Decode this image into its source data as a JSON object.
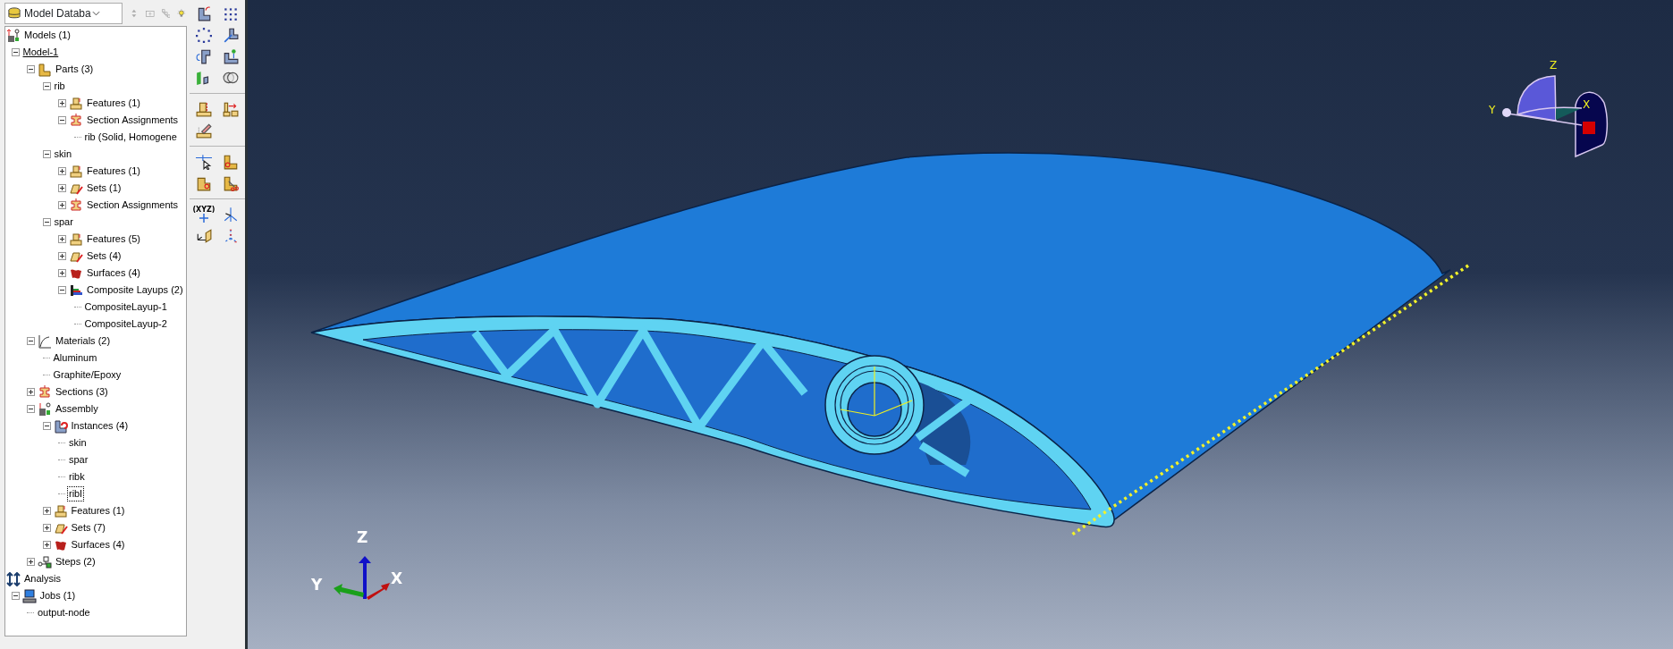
{
  "model_tree": {
    "selector": {
      "value": "Model Databa"
    },
    "nodes": [
      {
        "label": "Models (1)",
        "kind": "models",
        "selected": false,
        "children": [
          {
            "label": "Model-1",
            "kind": "model",
            "expanded": true,
            "current": true,
            "selected": false,
            "children": [
              {
                "label": "Parts (3)",
                "kind": "parts",
                "expanded": true,
                "selected": false,
                "children": [
                  {
                    "label": "rib",
                    "kind": "part",
                    "expanded": true,
                    "selected": false,
                    "children": [
                      {
                        "label": "Features (1)",
                        "kind": "features",
                        "expanded": false,
                        "selected": false
                      },
                      {
                        "label": "Section Assignments",
                        "kind": "section",
                        "expanded": true,
                        "selected": false,
                        "children": [
                          {
                            "label": "rib (Solid, Homogene",
                            "kind": "leaf",
                            "selected": false
                          }
                        ]
                      }
                    ]
                  },
                  {
                    "label": "skin",
                    "kind": "part",
                    "expanded": true,
                    "selected": false,
                    "children": [
                      {
                        "label": "Features (1)",
                        "kind": "features",
                        "expanded": false,
                        "selected": false
                      },
                      {
                        "label": "Sets (1)",
                        "kind": "sets",
                        "expanded": false,
                        "selected": false
                      },
                      {
                        "label": "Section Assignments",
                        "kind": "section",
                        "expanded": false,
                        "selected": false
                      }
                    ]
                  },
                  {
                    "label": "spar",
                    "kind": "part",
                    "expanded": true,
                    "selected": false,
                    "children": [
                      {
                        "label": "Features (5)",
                        "kind": "features",
                        "expanded": false,
                        "selected": false
                      },
                      {
                        "label": "Sets (4)",
                        "kind": "sets",
                        "expanded": false,
                        "selected": false
                      },
                      {
                        "label": "Surfaces (4)",
                        "kind": "surfaces",
                        "expanded": false,
                        "selected": false
                      },
                      {
                        "label": "Composite Layups (2)",
                        "kind": "layups",
                        "expanded": true,
                        "selected": false,
                        "children": [
                          {
                            "label": "CompositeLayup-1",
                            "kind": "leaf",
                            "selected": false
                          },
                          {
                            "label": "CompositeLayup-2",
                            "kind": "leaf",
                            "selected": false
                          }
                        ]
                      }
                    ]
                  }
                ]
              },
              {
                "label": "Materials (2)",
                "kind": "materials",
                "expanded": true,
                "selected": false,
                "children": [
                  {
                    "label": "Aluminum",
                    "kind": "leaf",
                    "selected": false
                  },
                  {
                    "label": "Graphite/Epoxy",
                    "kind": "leaf",
                    "selected": false
                  }
                ]
              },
              {
                "label": "Sections (3)",
                "kind": "section",
                "expanded": false,
                "selected": false
              },
              {
                "label": "Assembly",
                "kind": "assembly",
                "expanded": true,
                "selected": false,
                "children": [
                  {
                    "label": "Instances (4)",
                    "kind": "instances",
                    "expanded": true,
                    "selected": false,
                    "children": [
                      {
                        "label": "skin",
                        "kind": "leaf",
                        "selected": false
                      },
                      {
                        "label": "spar",
                        "kind": "leaf",
                        "selected": false
                      },
                      {
                        "label": "ribk",
                        "kind": "leaf",
                        "selected": false
                      },
                      {
                        "label": "ribl",
                        "kind": "leaf",
                        "selected": true
                      }
                    ]
                  },
                  {
                    "label": "Features (1)",
                    "kind": "features",
                    "expanded": false,
                    "selected": false
                  },
                  {
                    "label": "Sets (7)",
                    "kind": "sets",
                    "expanded": false,
                    "selected": false
                  },
                  {
                    "label": "Surfaces (4)",
                    "kind": "surfaces",
                    "expanded": false,
                    "selected": false
                  }
                ]
              },
              {
                "label": "Steps (2)",
                "kind": "steps",
                "expanded": false,
                "selected": false
              }
            ]
          }
        ]
      },
      {
        "label": "Analysis",
        "kind": "analysis",
        "selected": false,
        "children": [
          {
            "label": "Jobs (1)",
            "kind": "jobs",
            "expanded": true,
            "selected": false,
            "children": [
              {
                "label": "output-node",
                "kind": "leaf",
                "selected": false
              }
            ]
          }
        ]
      }
    ]
  },
  "toolbox": {
    "datum_label": "(XYZ)"
  },
  "viewport": {
    "triad": {
      "z": "Z",
      "y": "Y",
      "x": "X"
    },
    "view_cube": {
      "z": "Z",
      "y": "Y",
      "x": "X"
    }
  }
}
